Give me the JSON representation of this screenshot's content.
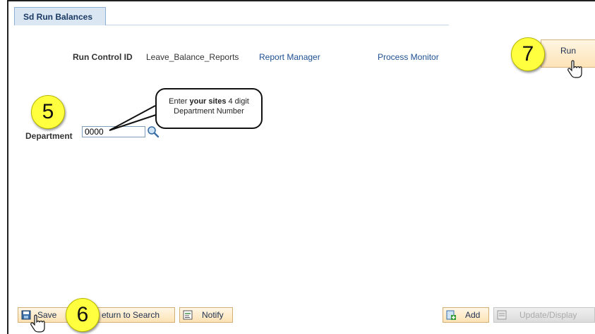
{
  "tab": {
    "label": "Sd Run Balances"
  },
  "run_control": {
    "label": "Run Control ID",
    "value": "Leave_Balance_Reports",
    "report_manager": "Report Manager",
    "process_monitor": "Process Monitor"
  },
  "run_button": {
    "label": "Run"
  },
  "callouts": {
    "step5": "5",
    "step6": "6",
    "step7": "7"
  },
  "department": {
    "label": "Department",
    "value": "0000"
  },
  "tooltip": {
    "prefix": "Enter ",
    "bold": "your sites",
    "suffix": " 4 digit",
    "line2": "Department Number"
  },
  "toolbar": {
    "save_label": "Save",
    "return_label": "eturn to Search",
    "notify_label": "Notify",
    "add_label": "Add",
    "update_label": "Update/Display"
  },
  "colors": {
    "callout": "#ffff40",
    "link": "#1d4f91",
    "button_bg": "#fce2b4",
    "tab_bg": "#dbe6f3"
  },
  "icons": [
    "lookup-magnifier-icon",
    "save-disk-icon",
    "notify-icon",
    "add-icon",
    "update-icon",
    "hand-cursor-icon"
  ]
}
